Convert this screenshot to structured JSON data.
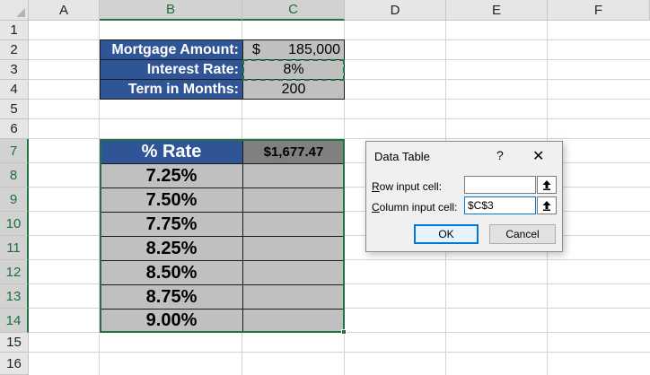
{
  "columns": [
    "A",
    "B",
    "C",
    "D",
    "E",
    "F"
  ],
  "rows": [
    "1",
    "2",
    "3",
    "4",
    "5",
    "6",
    "7",
    "8",
    "9",
    "10",
    "11",
    "12",
    "13",
    "14",
    "15",
    "16"
  ],
  "inputs": {
    "mortgage_label": "Mortgage Amount:",
    "mortgage_currency": "$",
    "mortgage_value": "185,000",
    "rate_label": "Interest Rate:",
    "rate_value": "8%",
    "term_label": "Term in Months:",
    "term_value": "200"
  },
  "table": {
    "header_rate": "% Rate",
    "header_payment": "$1,677.47",
    "rates": [
      "7.25%",
      "7.50%",
      "7.75%",
      "8.25%",
      "8.50%",
      "8.75%",
      "9.00%"
    ]
  },
  "dialog": {
    "title": "Data Table",
    "help": "?",
    "close": "✕",
    "row_input_label_key": "R",
    "row_input_label_rest": "ow input cell:",
    "row_input_value": "",
    "column_input_label_key": "C",
    "column_input_label_rest": "olumn input cell:",
    "column_input_value": "$C$3",
    "ok_label": "OK",
    "cancel_label": "Cancel"
  },
  "colors": {
    "header_blue": "#2f5597",
    "cell_gray": "#c0c0c0",
    "excel_green": "#217346",
    "dialog_accent": "#0078d7"
  }
}
